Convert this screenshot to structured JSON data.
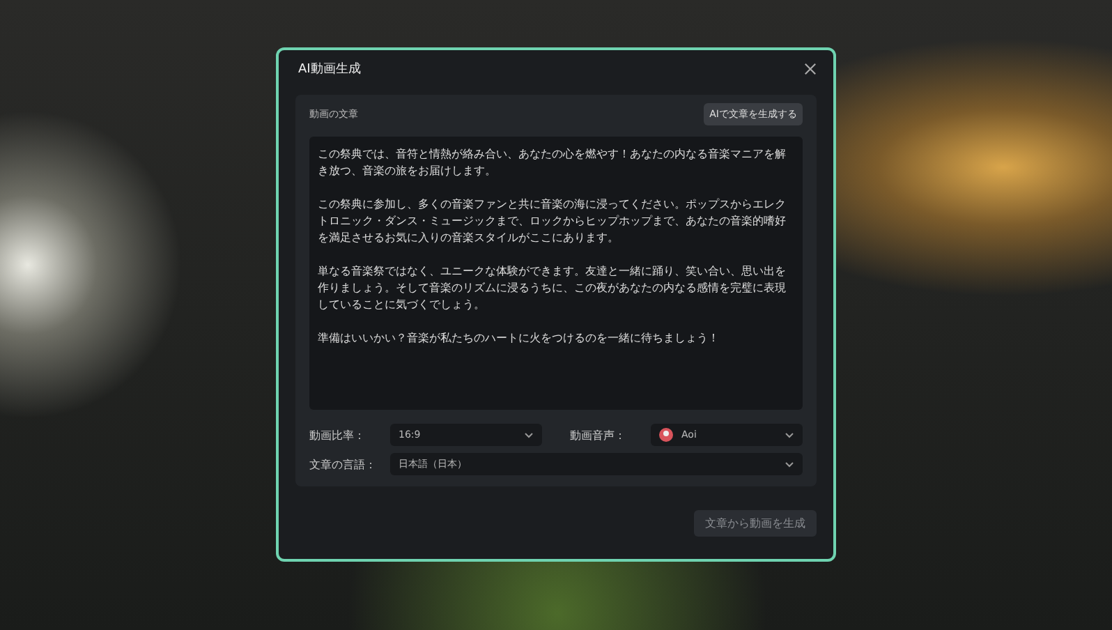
{
  "dialog": {
    "title": "AI動画生成",
    "script_section": {
      "label": "動画の文章",
      "generate_button": "AIで文章を生成する",
      "paragraphs": [
        "この祭典では、音符と情熱が絡み合い、あなたの心を燃やす！あなたの内なる音楽マニアを解き放つ、音楽の旅をお届けします。",
        "この祭典に参加し、多くの音楽ファンと共に音楽の海に浸ってください。ポップスからエレクトロニック・ダンス・ミュージックまで、ロックからヒップホップまで、あなたの音楽的嗜好を満足させるお気に入りの音楽スタイルがここにあります。",
        "単なる音楽祭ではなく、ユニークな体験ができます。友達と一緒に踊り、笑い合い、思い出を作りましょう。そして音楽のリズムに浸るうちに、この夜があなたの内なる感情を完璧に表現していることに気づくでしょう。",
        "準備はいいかい？音楽が私たちのハートに火をつけるのを一緒に待ちましょう！"
      ]
    },
    "fields": [
      {
        "label": "動画比率：",
        "value": "16:9",
        "kind": "plain"
      },
      {
        "label": "動画音声：",
        "value": "Aoi",
        "kind": "voice"
      },
      {
        "label": "文章の言語：",
        "value": "日本語（日本）",
        "kind": "plain"
      }
    ],
    "submit_button": {
      "label": "文章から動画を生成",
      "disabled": true
    }
  }
}
